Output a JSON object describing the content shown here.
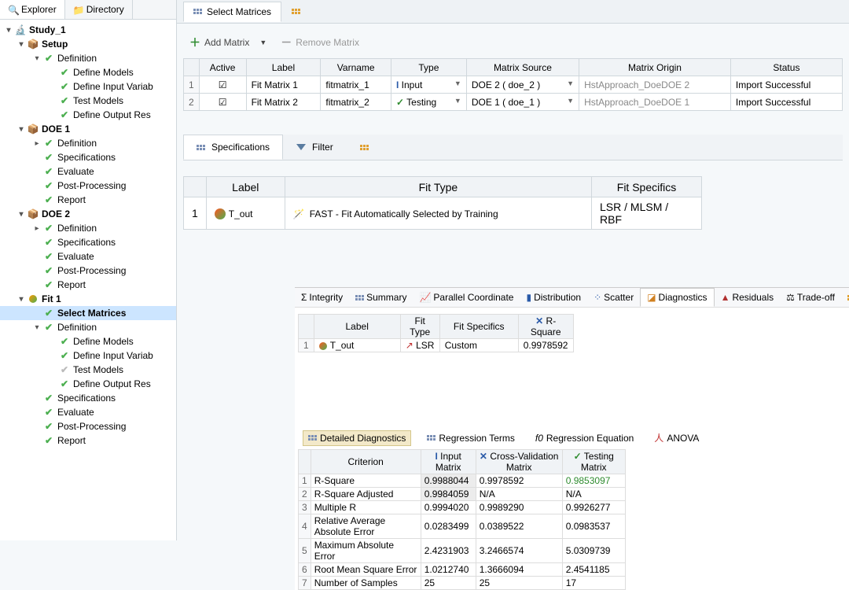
{
  "leftTabs": {
    "explorer": "Explorer",
    "directory": "Directory"
  },
  "tree": {
    "study": "Study_1",
    "setup": "Setup",
    "definition": "Definition",
    "defineModels": "Define Models",
    "defineInputVar": "Define Input Variab",
    "testModels": "Test Models",
    "defineOutputRes": "Define Output Res",
    "doe1": "DOE 1",
    "doe2": "DOE 2",
    "specifications": "Specifications",
    "evaluate": "Evaluate",
    "postProcessing": "Post-Processing",
    "report": "Report",
    "fit1": "Fit 1",
    "selectMatrices": "Select Matrices"
  },
  "mainTabs": {
    "selectMatrices": "Select Matrices"
  },
  "toolbar": {
    "addMatrix": "Add Matrix",
    "removeMatrix": "Remove Matrix"
  },
  "matrixTable": {
    "headers": {
      "active": "Active",
      "label": "Label",
      "varname": "Varname",
      "type": "Type",
      "source": "Matrix Source",
      "origin": "Matrix Origin",
      "status": "Status"
    },
    "rows": [
      {
        "n": "1",
        "label": "Fit Matrix 1",
        "varname": "fitmatrix_1",
        "type": "Input",
        "source": "DOE 2 ( doe_2 )",
        "origin": "HstApproach_DoeDOE 2",
        "status": "Import Successful"
      },
      {
        "n": "2",
        "label": "Fit Matrix 2",
        "varname": "fitmatrix_2",
        "type": "Testing",
        "source": "DOE 1 ( doe_1 )",
        "origin": "HstApproach_DoeDOE 1",
        "status": "Import Successful"
      }
    ]
  },
  "subTabs": {
    "specifications": "Specifications",
    "filter": "Filter"
  },
  "fitTable": {
    "headers": {
      "label": "Label",
      "fitType": "Fit Type",
      "specifics": "Fit Specifics"
    },
    "row": {
      "n": "1",
      "label": "T_out",
      "fitType": "FAST - Fit Automatically Selected by Training",
      "specifics": "LSR / MLSM / RBF"
    }
  },
  "diagTabs": {
    "integrity": "Integrity",
    "summary": "Summary",
    "parallel": "Parallel Coordinate",
    "distribution": "Distribution",
    "scatter": "Scatter",
    "diagnostics": "Diagnostics",
    "residuals": "Residuals",
    "tradeoff": "Trade-off"
  },
  "diagSmall": {
    "headers": {
      "label": "Label",
      "fitType": "Fit Type",
      "specifics": "Fit Specifics",
      "rsquare": "R-Square"
    },
    "row": {
      "n": "1",
      "label": "T_out",
      "fitType": "LSR",
      "specifics": "Custom",
      "rsquare": "0.9978592"
    }
  },
  "diagSubTabs": {
    "detailed": "Detailed Diagnostics",
    "regression": "Regression Terms",
    "equation": "Regression Equation",
    "anova": "ANOVA"
  },
  "criterion": {
    "headers": {
      "criterion": "Criterion",
      "input": "Input Matrix",
      "cross": "Cross-Validation Matrix",
      "testing": "Testing Matrix"
    },
    "rows": [
      {
        "n": "1",
        "c": "R-Square",
        "i": "0.9988044",
        "x": "0.9978592",
        "t": "0.9853097"
      },
      {
        "n": "2",
        "c": "R-Square Adjusted",
        "i": "0.9984059",
        "x": "N/A",
        "t": "N/A"
      },
      {
        "n": "3",
        "c": "Multiple R",
        "i": "0.9994020",
        "x": "0.9989290",
        "t": "0.9926277"
      },
      {
        "n": "4",
        "c": "Relative Average Absolute Error",
        "i": "0.0283499",
        "x": "0.0389522",
        "t": "0.0983537"
      },
      {
        "n": "5",
        "c": "Maximum Absolute Error",
        "i": "2.4231903",
        "x": "3.2466574",
        "t": "5.0309739"
      },
      {
        "n": "6",
        "c": "Root Mean Square Error",
        "i": "1.0212740",
        "x": "1.3666094",
        "t": "2.4541185"
      },
      {
        "n": "7",
        "c": "Number of Samples",
        "i": "25",
        "x": "25",
        "t": "17"
      }
    ]
  },
  "iconGlyphs": {
    "sigma": "Σ",
    "fx": "f()",
    "ital": "f0",
    "scale": "⚖"
  }
}
